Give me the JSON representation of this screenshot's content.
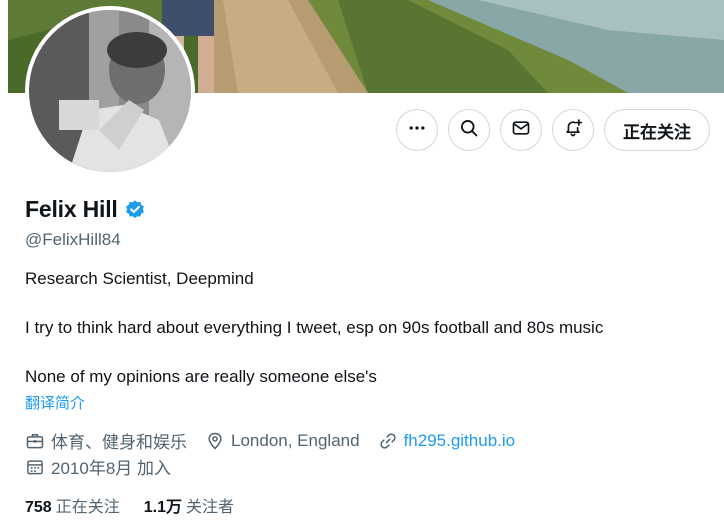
{
  "profile": {
    "name": "Felix Hill",
    "handle": "@FelixHill84",
    "bio_line1": "Research Scientist, Deepmind",
    "bio_line2": "I try to think hard about everything I tweet, esp on 90s football and 80s music",
    "bio_line3": "None of my opinions are really someone else's",
    "translate_label": "翻译简介"
  },
  "actions": {
    "more_icon": "more-icon",
    "search_icon": "search-icon",
    "message_icon": "mail-icon",
    "notify_icon": "bell-plus-icon",
    "follow_label": "正在关注"
  },
  "meta": {
    "category": "体育、健身和娱乐",
    "location": "London, England",
    "website": "fh295.github.io",
    "joined": "2010年8月 加入"
  },
  "stats": {
    "following_count": "758",
    "following_label": "正在关注",
    "followers_count": "1.1万",
    "followers_label": "关注者"
  },
  "colors": {
    "accent": "#1d9bf0",
    "secondary_text": "#536471",
    "border": "#cfd9de"
  }
}
